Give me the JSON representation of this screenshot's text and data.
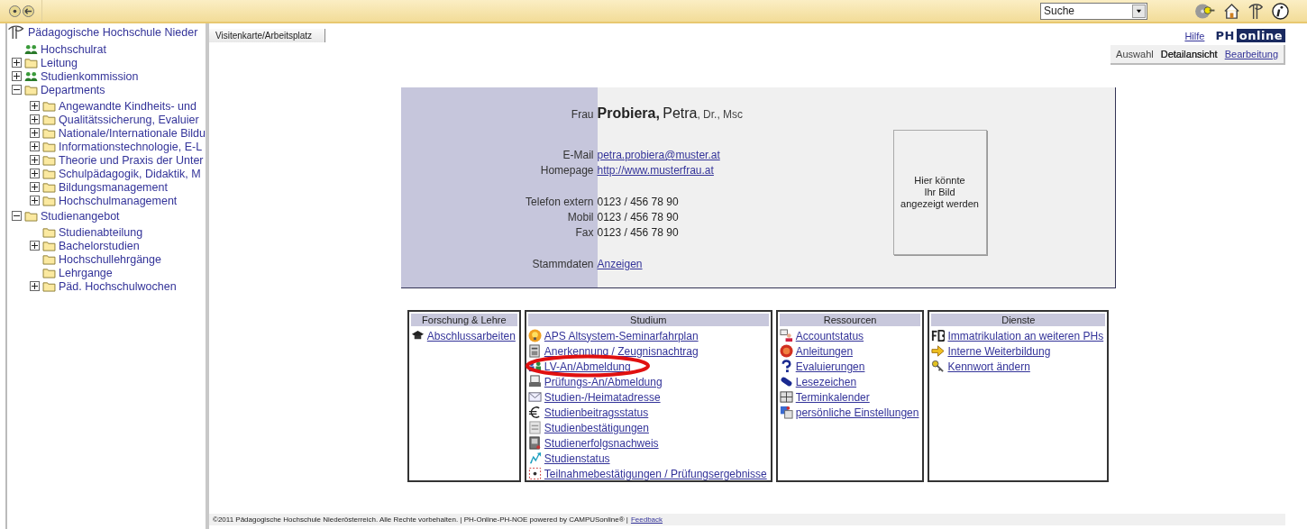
{
  "topbar": {
    "search": {
      "value": "Suche"
    }
  },
  "sidebar": {
    "title": "Pädagogische Hochschule Nieder",
    "tree": [
      {
        "label": "Hochschulrat",
        "kind": "group"
      },
      {
        "label": "Leitung",
        "kind": "folder",
        "expanded": false
      },
      {
        "label": "Studienkommission",
        "kind": "group",
        "expanded": false
      },
      {
        "label": "Departments",
        "kind": "folder",
        "expanded": true,
        "children": [
          {
            "label": "Angewandte Kindheits- und",
            "kind": "folder",
            "expanded": false
          },
          {
            "label": "Qualitätssicherung, Evaluier",
            "kind": "folder",
            "expanded": false
          },
          {
            "label": "Nationale/Internationale Bildu",
            "kind": "folder",
            "expanded": false
          },
          {
            "label": "Informationstechnologie, E-L",
            "kind": "folder",
            "expanded": false
          },
          {
            "label": "Theorie und Praxis der Unter",
            "kind": "folder",
            "expanded": false
          },
          {
            "label": "Schulpädagogik, Didaktik, M",
            "kind": "folder",
            "expanded": false
          },
          {
            "label": "Bildungsmanagement",
            "kind": "folder",
            "expanded": false
          },
          {
            "label": "Hochschulmanagement",
            "kind": "folder",
            "expanded": false
          }
        ]
      },
      {
        "label": "Studienangebot",
        "kind": "folder",
        "expanded": true,
        "children": [
          {
            "label": "Studienabteilung",
            "kind": "folder"
          },
          {
            "label": "Bachelorstudien",
            "kind": "folder",
            "expanded": false
          },
          {
            "label": "Hochschullehrgänge",
            "kind": "folder"
          },
          {
            "label": "Lehrgange",
            "kind": "folder"
          },
          {
            "label": "Päd. Hochschulwochen",
            "kind": "folder",
            "expanded": false
          }
        ]
      }
    ]
  },
  "page_tab": "Visitenkarte/Arbeitsplatz",
  "help": "Hilfe",
  "logo": {
    "left": "PH",
    "right": "online"
  },
  "view_tabs": [
    {
      "label": "Auswahl",
      "selected": false
    },
    {
      "label": "Detailansicht",
      "selected": true
    },
    {
      "label": "Bearbeitung",
      "selected": false
    }
  ],
  "card": {
    "salutation": "Frau",
    "surname": "Probiera,",
    "given": "Petra",
    "titles": ", Dr., Msc",
    "field_groups": [
      [
        {
          "label": "E-Mail",
          "value": "petra.probiera@muster.at",
          "kind": "link"
        },
        {
          "label": "Homepage",
          "value": "http://www.musterfrau.at",
          "kind": "link"
        }
      ],
      [
        {
          "label": "Telefon extern",
          "value": "0123 / 456 78 90",
          "kind": "text"
        },
        {
          "label": "Mobil",
          "value": "0123 / 456 78 90",
          "kind": "text"
        },
        {
          "label": "Fax",
          "value": "0123 / 456 78 90",
          "kind": "text"
        }
      ],
      [
        {
          "label": "Stammdaten",
          "value": "Anzeigen",
          "kind": "link"
        }
      ]
    ],
    "photo_placeholder": [
      "Hier könnte",
      "Ihr Bild",
      "angezeigt werden"
    ]
  },
  "sections": [
    {
      "title": "Forschung & Lehre",
      "items": [
        {
          "label": "Abschlussarbeiten",
          "highlighted": false
        }
      ]
    },
    {
      "title": "Studium",
      "items": [
        {
          "label": "APS Altsystem-Seminarfahrplan",
          "highlighted": false
        },
        {
          "label": "Anerkennung / Zeugnisnachtrag",
          "highlighted": false
        },
        {
          "label": "LV-An/Abmeldung",
          "highlighted": true
        },
        {
          "label": "Prüfungs-An/Abmeldung",
          "highlighted": false
        },
        {
          "label": "Studien-/Heimatadresse",
          "highlighted": false
        },
        {
          "label": "Studienbeitragsstatus",
          "highlighted": false
        },
        {
          "label": "Studienbestätigungen",
          "highlighted": false
        },
        {
          "label": "Studienerfolgsnachweis",
          "highlighted": false
        },
        {
          "label": "Studienstatus",
          "highlighted": false
        },
        {
          "label": "Teilnahmebestätigungen / Prüfungsergebnisse",
          "highlighted": false
        }
      ]
    },
    {
      "title": "Ressourcen",
      "items": [
        {
          "label": "Accountstatus",
          "highlighted": false
        },
        {
          "label": "Anleitungen",
          "highlighted": false
        },
        {
          "label": "Evaluierungen",
          "highlighted": false
        },
        {
          "label": "Lesezeichen",
          "highlighted": false
        },
        {
          "label": "Terminkalender",
          "highlighted": false
        },
        {
          "label": "persönliche Einstellungen",
          "highlighted": false
        }
      ]
    },
    {
      "title": "Dienste",
      "items": [
        {
          "label": "Immatrikulation an weiteren PHs",
          "highlighted": false
        },
        {
          "label": "Interne Weiterbildung",
          "highlighted": false
        },
        {
          "label": "Kennwort ändern",
          "highlighted": false
        }
      ]
    }
  ],
  "footer": {
    "text": "©2011 Pädagogische Hochschule Niederösterreich. Alle Rechte vorbehalten. | PH-Online-PH-NOE powered by CAMPUSonline® |",
    "link": "Feedback"
  }
}
